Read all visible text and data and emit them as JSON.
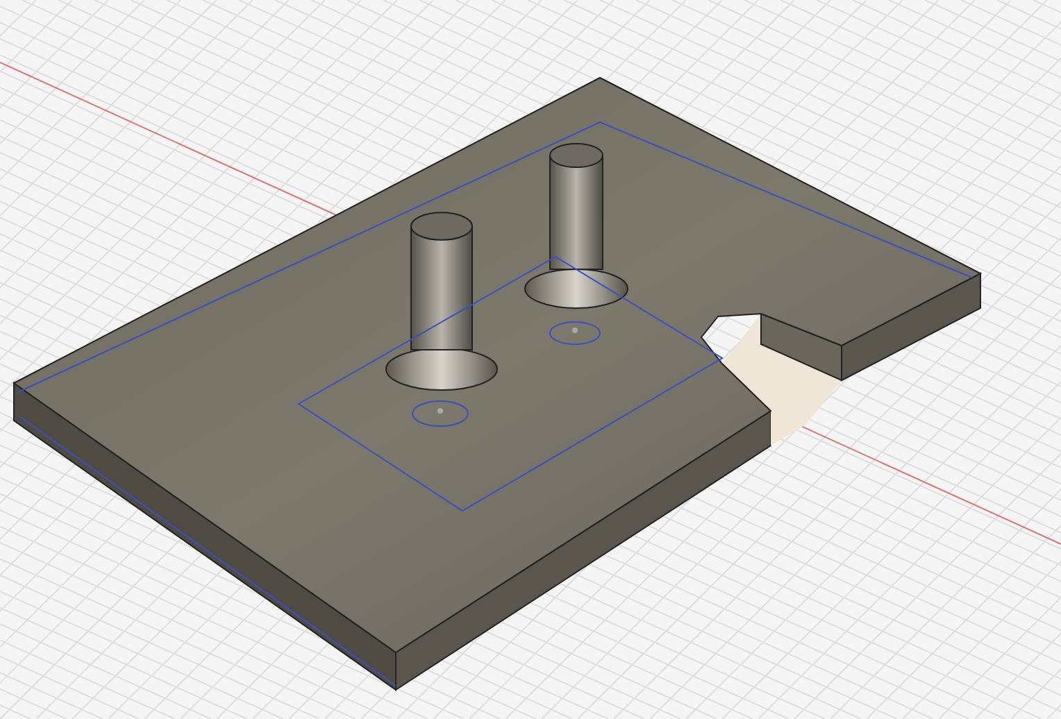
{
  "viewport": {
    "grid": true,
    "axis": true,
    "sketch": true
  }
}
